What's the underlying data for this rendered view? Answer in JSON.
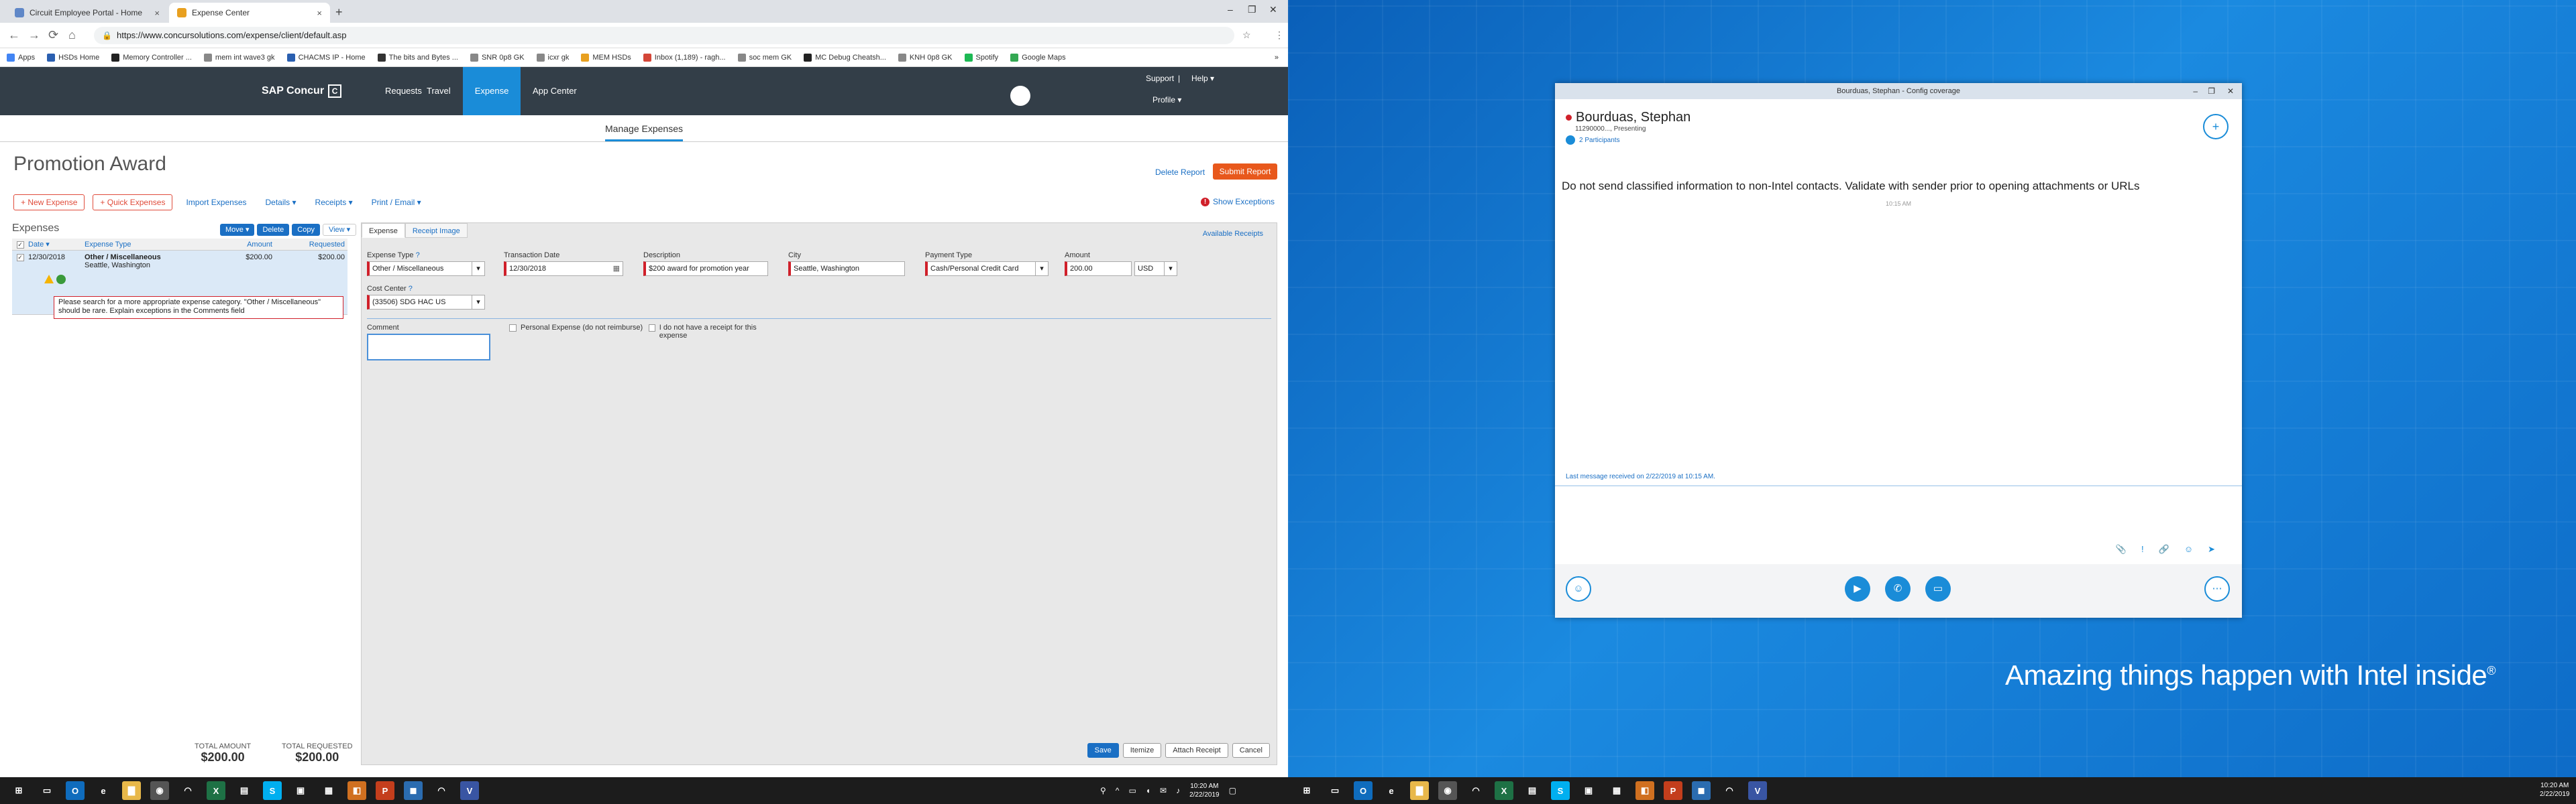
{
  "browser": {
    "tabs": [
      {
        "label": "Circuit Employee Portal - Home",
        "color": "#5f87c7"
      },
      {
        "label": "Expense Center",
        "color": "#e8a020"
      }
    ],
    "new_tab": "+",
    "close_glyph": "×",
    "window_controls": [
      "–",
      "❐",
      "✕"
    ],
    "nav": [
      "←",
      "→",
      "⟳",
      "⌂"
    ],
    "url": "https://www.concursolutions.com/expense/client/default.asp",
    "actions": [
      "☆",
      "⋮"
    ],
    "bookmarks": [
      {
        "label": "Apps",
        "color": "#4285f4"
      },
      {
        "label": "HSDs Home",
        "color": "#2a5fb0"
      },
      {
        "label": "Memory Controller ...",
        "color": "#222"
      },
      {
        "label": "mem int wave3 gk",
        "color": "#888"
      },
      {
        "label": "CHACMS IP - Home",
        "color": "#2a5fb0"
      },
      {
        "label": "The bits and Bytes ...",
        "color": "#333"
      },
      {
        "label": "SNR 0p8 GK",
        "color": "#888"
      },
      {
        "label": "icxr gk",
        "color": "#888"
      },
      {
        "label": "MEM HSDs",
        "color": "#e8a020"
      },
      {
        "label": "Inbox (1,189) - ragh...",
        "color": "#d44638"
      },
      {
        "label": "soc mem GK",
        "color": "#888"
      },
      {
        "label": "MC Debug Cheatsh...",
        "color": "#222"
      },
      {
        "label": "KNH 0p8 GK",
        "color": "#888"
      },
      {
        "label": "Spotify",
        "color": "#1db954"
      },
      {
        "label": "Google Maps",
        "color": "#34a853"
      }
    ],
    "more": "»"
  },
  "concur": {
    "brand": "SAP Concur",
    "brand_mark": "C",
    "nav": [
      "Requests",
      "Travel",
      "Expense",
      "App Center"
    ],
    "support": "Support",
    "divider": "|",
    "help": "Help ▾",
    "profile": "Profile ▾",
    "subnav": "Manage Expenses"
  },
  "report": {
    "title": "Promotion Award",
    "delete_label": "Delete Report",
    "submit_label": "Submit Report",
    "toolbar": {
      "new_expense": "+ New Expense",
      "quick_expenses": "+ Quick Expenses",
      "import": "Import Expenses",
      "details": "Details ▾",
      "receipts": "Receipts ▾",
      "print": "Print / Email ▾"
    },
    "show_exceptions": "Show Exceptions",
    "exception_glyph": "!"
  },
  "expenses": {
    "heading": "Expenses",
    "buttons": [
      "Move ▾",
      "Delete",
      "Copy",
      "View ▾"
    ],
    "columns": [
      "Date ▾",
      "Expense Type",
      "Amount",
      "Requested"
    ],
    "check_glyph": "✓",
    "row": {
      "date": "12/30/2018",
      "type": "Other / Miscellaneous",
      "location": "Seattle, Washington",
      "amount": "$200.00",
      "requested": "$200.00",
      "warning": "Please search for a more appropriate expense category. \"Other / Miscellaneous\" should be rare. Explain exceptions in the Comments field"
    },
    "total_amount_label": "TOTAL AMOUNT",
    "total_amount": "$200.00",
    "total_requested_label": "TOTAL REQUESTED",
    "total_requested": "$200.00"
  },
  "detail": {
    "tabs": [
      "Expense",
      "Receipt Image"
    ],
    "available_receipts": "Available Receipts",
    "expense_type_label": "Expense Type",
    "expense_type": "Other / Miscellaneous",
    "transaction_date_label": "Transaction Date",
    "transaction_date": "12/30/2018",
    "description_label": "Description",
    "description": "$200 award for promotion year",
    "city_label": "City",
    "city": "Seattle, Washington",
    "payment_type_label": "Payment Type",
    "payment_type": "Cash/Personal Credit Card",
    "amount_label": "Amount",
    "amount": "200.00",
    "currency": "USD",
    "cost_center_label": "Cost Center",
    "cost_center": "(33506) SDG HAC US",
    "comment_label": "Comment",
    "personal_expense": "Personal Expense (do not reimburse)",
    "no_receipt": "I do not have a receipt for this expense",
    "help_glyph": "?",
    "calendar_glyph": "▦",
    "buttons": [
      "Save",
      "Itemize",
      "Attach Receipt",
      "Cancel"
    ]
  },
  "taskbar_left": {
    "icons": [
      {
        "name": "windows-start-icon",
        "glyph": "⊞",
        "color": "transparent"
      },
      {
        "name": "task-view-icon",
        "glyph": "▭",
        "color": "transparent"
      },
      {
        "name": "outlook-icon",
        "glyph": "O",
        "color": "#0f6cbd"
      },
      {
        "name": "edge-icon",
        "glyph": "e",
        "color": "transparent"
      },
      {
        "name": "file-explorer-icon",
        "glyph": "▇",
        "color": "#e8b84a"
      },
      {
        "name": "chrome-icon",
        "glyph": "◉",
        "color": "#555"
      },
      {
        "name": "circuit-icon",
        "glyph": "◠",
        "color": "transparent"
      },
      {
        "name": "excel-icon",
        "glyph": "X",
        "color": "#1e7145"
      },
      {
        "name": "document-icon",
        "glyph": "▤",
        "color": "transparent"
      },
      {
        "name": "skype-icon",
        "glyph": "S",
        "color": "#00aff0"
      },
      {
        "name": "terminal-icon",
        "glyph": "▣",
        "color": "transparent"
      },
      {
        "name": "calculator-icon",
        "glyph": "▦",
        "color": "transparent"
      },
      {
        "name": "app-orange-icon",
        "glyph": "◧",
        "color": "#d07020"
      },
      {
        "name": "powerpoint-icon",
        "glyph": "P",
        "color": "#c43e1c"
      },
      {
        "name": "app-blue-icon",
        "glyph": "◼",
        "color": "#2b6cb0"
      },
      {
        "name": "app-dark-icon",
        "glyph": "◠",
        "color": "transparent"
      },
      {
        "name": "visio-icon",
        "glyph": "V",
        "color": "#3955a3"
      }
    ],
    "tray": [
      "⚲",
      "^",
      "▭",
      "◖",
      "✉",
      "♪"
    ],
    "time": "10:20 AM",
    "date": "2/22/2019",
    "notify": "▢"
  },
  "taskbar_right": {
    "time": "10:20 AM",
    "date": "2/22/2019"
  },
  "skype": {
    "title": "Bourduas, Stephan - Config coverage",
    "window_controls": [
      "–",
      "❐",
      "✕"
    ],
    "name": "Bourduas, Stephan",
    "subtitle": "11290000..., Presenting",
    "participants": "2 Participants",
    "banner": "Do not send classified information to non-Intel contacts. Validate with sender prior to opening attachments or URLs",
    "time": "10:15 AM",
    "last_message": "Last message received on 2/22/2019 at 10:15 AM.",
    "tools": [
      "📎",
      "!",
      "🔗",
      "☺",
      "➤"
    ],
    "add_glyph": "+",
    "bottom_buttons": [
      "☺",
      "▶",
      "✆",
      "▭",
      "⋯"
    ]
  },
  "desktop": {
    "slogan": "Amazing things happen with Intel inside",
    "reg": "®"
  }
}
